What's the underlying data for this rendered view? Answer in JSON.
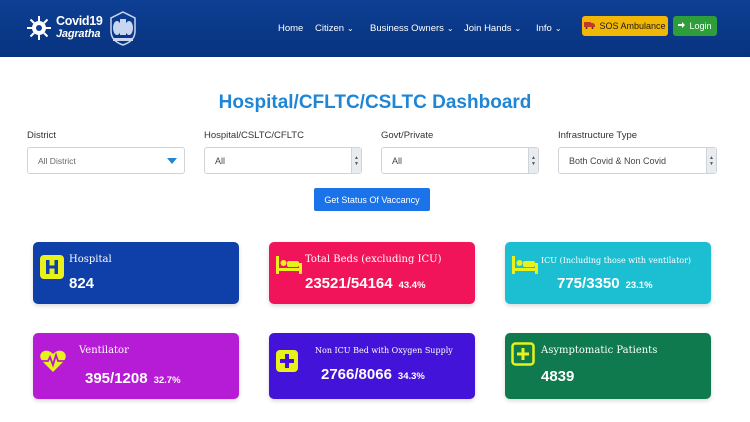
{
  "header": {
    "logo_line1": "Covid19",
    "logo_line2": "Jagratha",
    "nav": [
      {
        "label": "Home",
        "dropdown": false
      },
      {
        "label": "Citizen",
        "dropdown": true
      },
      {
        "label": "Business Owners",
        "dropdown": true
      },
      {
        "label": "Join Hands",
        "dropdown": true
      },
      {
        "label": "Info",
        "dropdown": true
      }
    ],
    "sos_label": "SOS Ambulance",
    "login_label": "Login"
  },
  "page_title": "Hospital/CFLTC/CSLTC Dashboard",
  "filters": [
    {
      "label": "District",
      "value": "All District"
    },
    {
      "label": "Hospital/CSLTC/CFLTC",
      "value": "All"
    },
    {
      "label": "Govt/Private",
      "value": "All"
    },
    {
      "label": "Infrastructure Type",
      "value": "Both Covid & Non Covid"
    }
  ],
  "status_button": "Get Status Of Vaccancy",
  "cards": [
    {
      "title": "Hospital",
      "value": "824",
      "percent": "",
      "icon": "hospital-icon",
      "color": "#0f3fa8"
    },
    {
      "title": "Total Beds (excluding ICU)",
      "value": "23521/54164",
      "percent": "43.4%",
      "icon": "bed-icon",
      "color": "#f2145a"
    },
    {
      "title": "ICU (Including those with ventilator)",
      "value": "775/3350",
      "percent": "23.1%",
      "icon": "bed-icon",
      "color": "#1bbfd1"
    },
    {
      "title": "Ventilator",
      "value": "395/1208",
      "percent": "32.7%",
      "icon": "heartbeat-icon",
      "color": "#b61bd6"
    },
    {
      "title": "Non ICU Bed with Oxygen Supply",
      "value": "2766/8066",
      "percent": "34.3%",
      "icon": "plus-icon",
      "color": "#4313d9"
    },
    {
      "title": "Asymptomatic Patients",
      "value": "4839",
      "percent": "",
      "icon": "plus-square-icon",
      "color": "#0e7a4d"
    }
  ]
}
